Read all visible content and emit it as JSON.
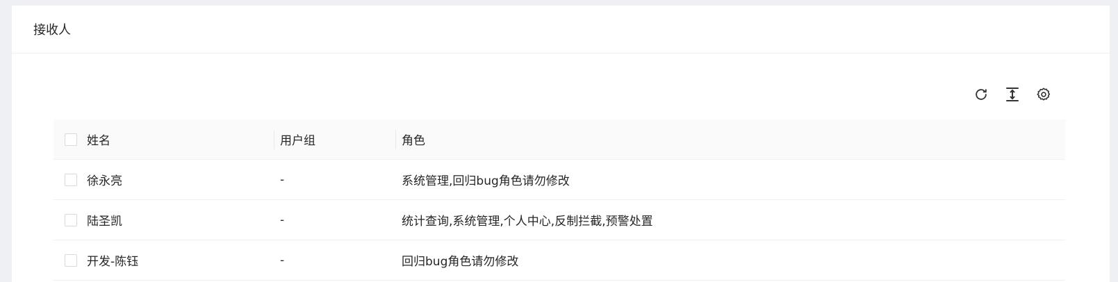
{
  "card": {
    "title": "接收人"
  },
  "toolbar": {
    "icons": [
      "refresh-icon",
      "density-icon",
      "settings-icon"
    ]
  },
  "table": {
    "columns": [
      "姓名",
      "用户组",
      "角色"
    ],
    "rows": [
      {
        "name": "徐永亮",
        "group": "-",
        "role": "系统管理,回归bug角色请勿修改"
      },
      {
        "name": "陆圣凯",
        "group": "-",
        "role": "统计查询,系统管理,个人中心,反制拦截,预警处置"
      },
      {
        "name": "开发-陈钰",
        "group": "-",
        "role": "回归bug角色请勿修改"
      }
    ]
  }
}
